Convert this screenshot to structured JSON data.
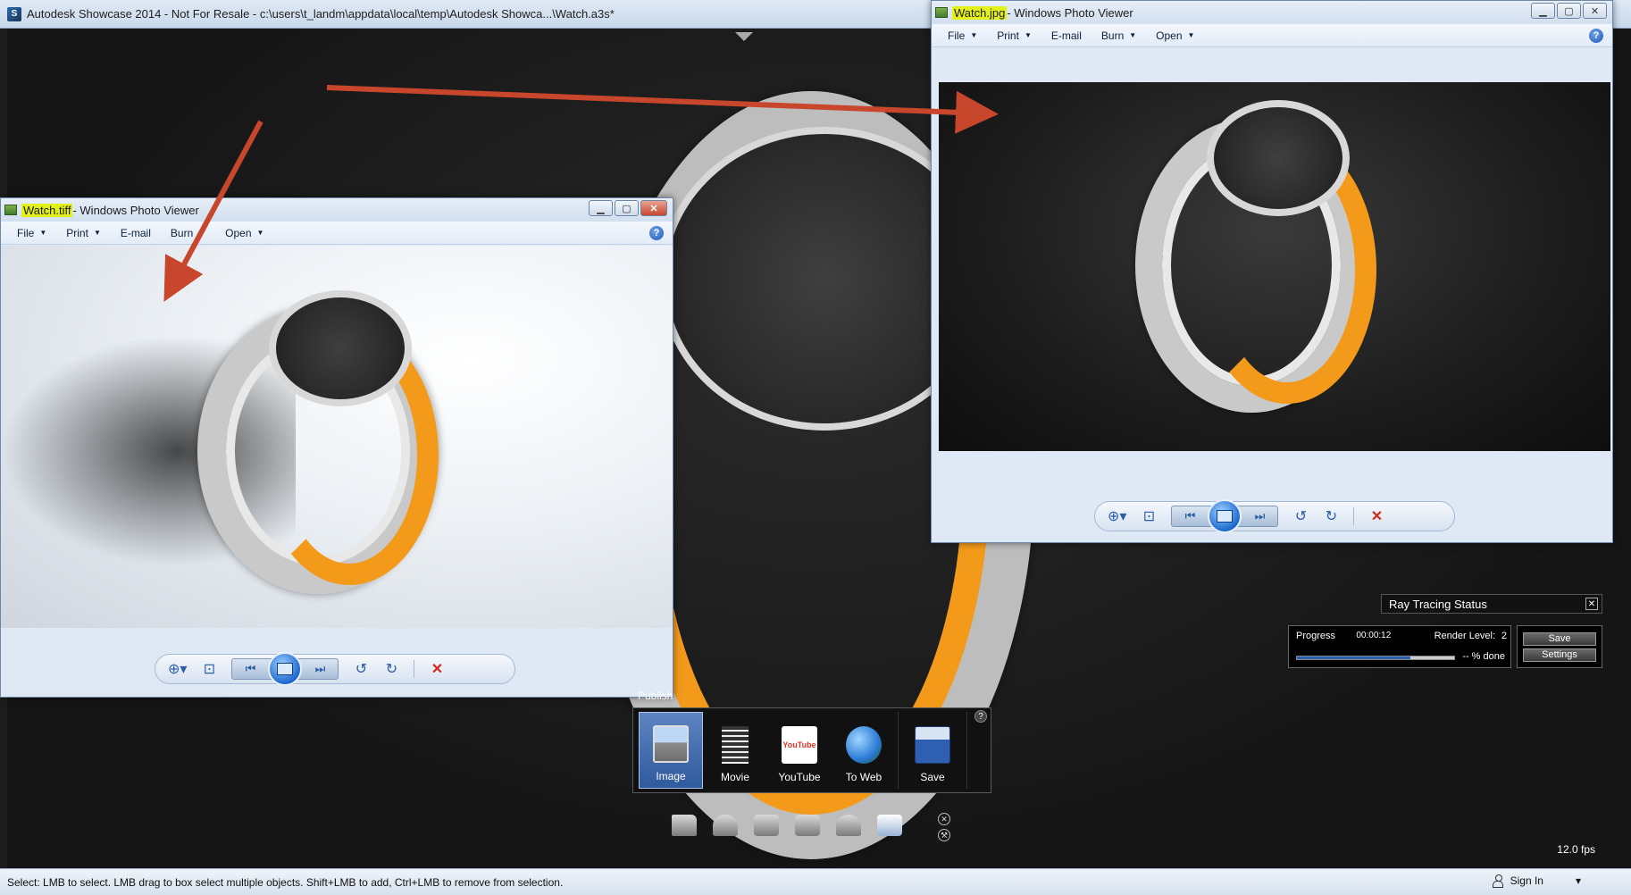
{
  "showcase": {
    "title": "Autodesk Showcase 2014 - Not For Resale - c:\\users\\t_landm\\appdata\\local\\temp\\Autodesk Showca...\\Watch.a3s*",
    "app_icon_letter": "S"
  },
  "status_bar": {
    "message": "Select: LMB to select. LMB drag to box select multiple objects. Shift+LMB to add, Ctrl+LMB to remove from selection.",
    "sign_in": "Sign In",
    "sign_in_caret": "▾"
  },
  "fps": "12.0 fps",
  "viewer_tiff": {
    "title_highlight": "Watch.tiff",
    "title_rest": " - Windows Photo Viewer",
    "menu": [
      "File",
      "Print",
      "E-mail",
      "Burn",
      "Open"
    ],
    "help": "?"
  },
  "viewer_jpg": {
    "title_highlight": "Watch.jpg",
    "title_rest": " - Windows Photo Viewer",
    "menu": [
      "File",
      "Print",
      "E-mail",
      "Burn",
      "Open"
    ],
    "help": "?"
  },
  "ray_tracing": {
    "title": "Ray Tracing Status",
    "progress_label": "Progress",
    "time": "00:00:12",
    "render_level_label": "Render Level:",
    "render_level": "2",
    "percent": "-- % done",
    "progress_fraction": 0.72,
    "save": "Save",
    "settings": "Settings",
    "close": "✕"
  },
  "publish": {
    "label": "Publish",
    "items": [
      {
        "label": "Image",
        "selected": true
      },
      {
        "label": "Movie",
        "selected": false
      },
      {
        "label": "YouTube",
        "selected": false
      },
      {
        "label": "To Web",
        "selected": false
      },
      {
        "label": "Save",
        "selected": false
      }
    ],
    "help": "?",
    "youtube_logo": "YouTube"
  },
  "colors": {
    "arrow": "#c8462c",
    "highlight": "#e3f11a",
    "accent_orange": "#f39a1b"
  }
}
